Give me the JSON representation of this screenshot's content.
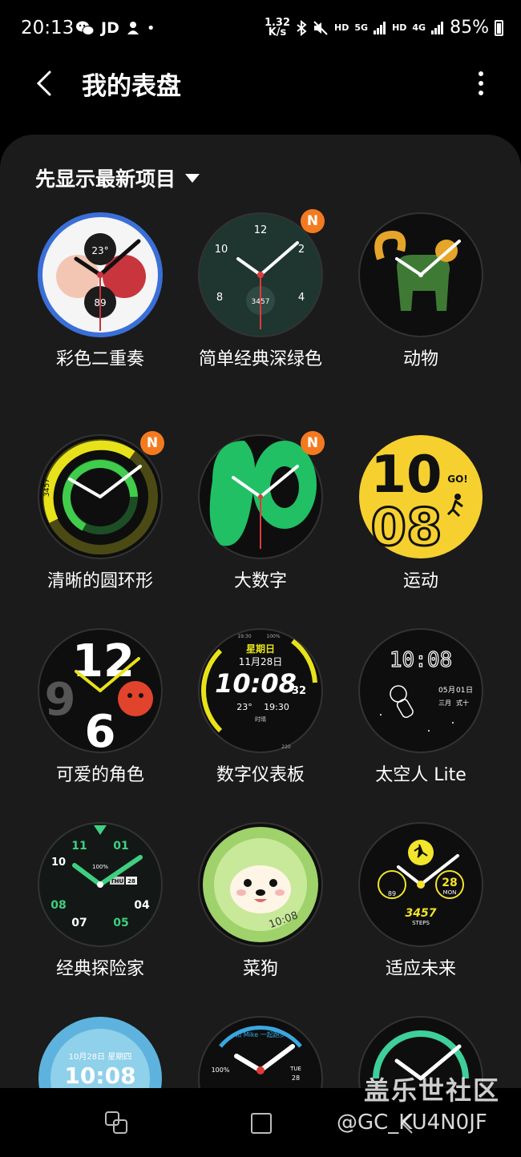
{
  "status": {
    "time": "20:13",
    "left_icons": [
      "wechat-icon",
      "JD",
      "notification-icon",
      "•"
    ],
    "net_speed_top": "1.32",
    "net_speed_bottom": "K/s",
    "hd1": "HD",
    "net1": "5G",
    "hd2": "HD",
    "net2": "4G",
    "battery": "85%"
  },
  "appbar": {
    "title": "我的表盘"
  },
  "sort": {
    "label": "先显示最新项目"
  },
  "faces": [
    {
      "label": "彩色二重奏",
      "badge": "",
      "top_text": "23°",
      "bottom_text": "89"
    },
    {
      "label": "简单经典深绿色",
      "badge": "N",
      "n12": "12",
      "n2": "2",
      "n4": "4",
      "n8": "8",
      "n10": "10",
      "steps": "3457"
    },
    {
      "label": "动物",
      "badge": ""
    },
    {
      "label": "清晰的圆环形",
      "badge": "N",
      "side": "3457"
    },
    {
      "label": "大数字",
      "badge": "N"
    },
    {
      "label": "运动",
      "badge": "",
      "hh": "10",
      "mm": "08",
      "go": "GO!"
    },
    {
      "label": "可爱的角色",
      "badge": "",
      "n12": "12",
      "n9": "9",
      "n6": "6"
    },
    {
      "label": "数字仪表板",
      "badge": "",
      "day": "星期日",
      "date": "11月28日",
      "time": "10:08",
      "sec": "32",
      "temp": "23°",
      "time2": "19:30",
      "t1": "19:30",
      "t2": "100%",
      "t3": "时晴",
      "t4": "220"
    },
    {
      "label": "太空人 Lite",
      "badge": "",
      "time": "10:08",
      "d1": "05",
      "d2": "月",
      "d3": "01",
      "d4": "日",
      "d5": "三月",
      "d6": "式十"
    },
    {
      "label": "经典探险家",
      "badge": "",
      "n11": "11",
      "n01": "01",
      "n10": "10",
      "n08": "08",
      "n04": "04",
      "n07": "07",
      "n05": "05",
      "pct": "100%",
      "day": "THU",
      "date": "28"
    },
    {
      "label": "菜狗",
      "badge": "",
      "time": "10:08"
    },
    {
      "label": "适应未来",
      "badge": "",
      "hr": "89",
      "date": "28",
      "mon": "MON",
      "steps": "3457",
      "steps_lbl": "STEPS"
    },
    {
      "label": "",
      "badge": "",
      "date": "10月28日 星期四",
      "time": "10:08"
    },
    {
      "label": "",
      "badge": "",
      "top": "和 Mike 一起跑步",
      "pct": "100%",
      "day": "TUE",
      "date": "28"
    },
    {
      "label": "",
      "badge": ""
    }
  ],
  "watermark": {
    "logo": "盖乐世社区",
    "handle": "@GC_KU4N0JF"
  },
  "colors": {
    "background": "#000000",
    "panel": "#1b1b1b",
    "badge": "#f47a1f"
  }
}
